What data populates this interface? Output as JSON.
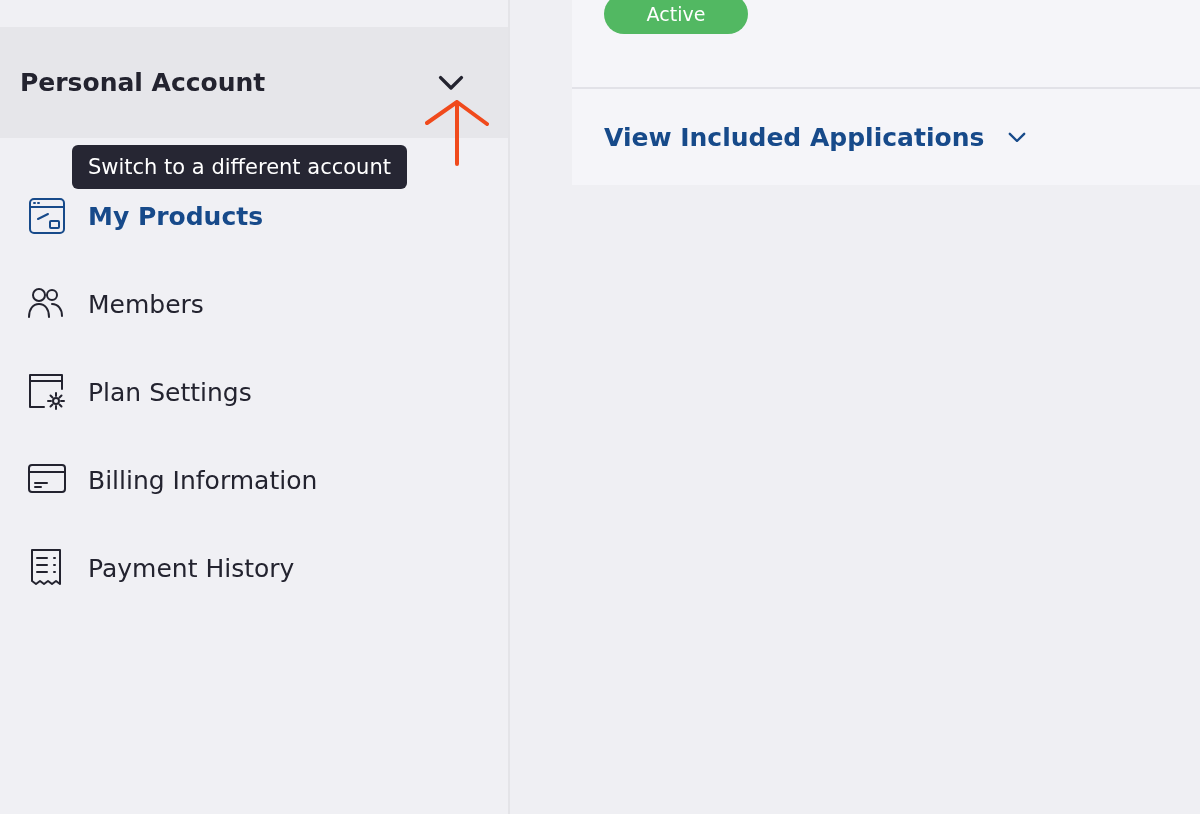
{
  "account_switcher": {
    "label": "Personal Account",
    "expanded": false,
    "tooltip": "Switch to a different account"
  },
  "sidebar": {
    "items": [
      {
        "label": "My Products",
        "kind": "window",
        "selected": true
      },
      {
        "label": "Members",
        "kind": "people",
        "selected": false
      },
      {
        "label": "Plan Settings",
        "kind": "window-gear",
        "selected": false
      },
      {
        "label": "Billing Information",
        "kind": "card",
        "selected": false
      },
      {
        "label": "Payment History",
        "kind": "receipt",
        "selected": false
      }
    ]
  },
  "product_card": {
    "status": "Active",
    "link": {
      "label": "View Included Applications",
      "expanded": false
    }
  }
}
